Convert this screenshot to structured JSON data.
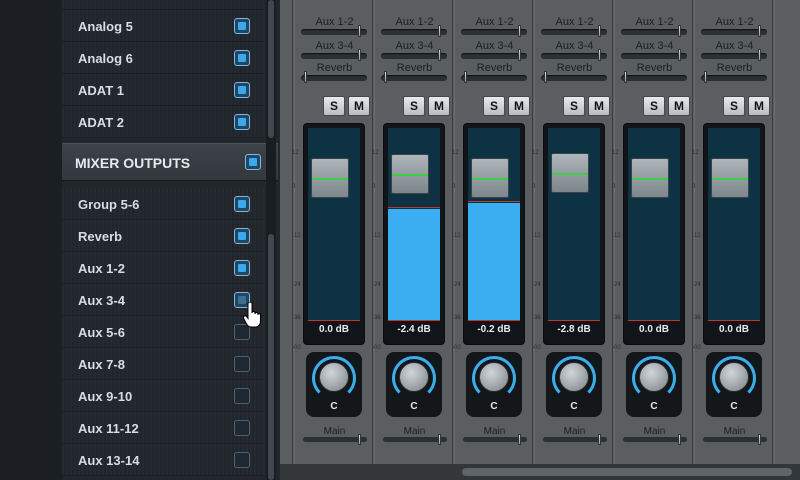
{
  "sidebar": {
    "inputs": [
      {
        "label": "Analog 5",
        "checked": true
      },
      {
        "label": "Analog 6",
        "checked": true
      },
      {
        "label": "ADAT 1",
        "checked": true
      },
      {
        "label": "ADAT 2",
        "checked": true
      }
    ],
    "mixer_outputs_header": "MIXER OUTPUTS",
    "outputs": [
      {
        "label": "Group 5-6",
        "checked": true
      },
      {
        "label": "Reverb",
        "checked": true
      },
      {
        "label": "Aux 1-2",
        "checked": true
      },
      {
        "label": "Aux 3-4",
        "checked": false,
        "hover": true
      },
      {
        "label": "Aux 5-6",
        "checked": false
      },
      {
        "label": "Aux 7-8",
        "checked": false
      },
      {
        "label": "Aux 9-10",
        "checked": false
      },
      {
        "label": "Aux 11-12",
        "checked": false
      },
      {
        "label": "Aux 13-14",
        "checked": false
      }
    ]
  },
  "mixer": {
    "solo_label": "S",
    "mute_label": "M",
    "main_label": "Main",
    "scale_labels": [
      "12",
      "0",
      "-12",
      "-24",
      "-36",
      "-00"
    ],
    "channels": [
      {
        "sends": [
          {
            "name": "Aux 1-2",
            "level": 0.92
          },
          {
            "name": "Aux 3-4",
            "level": 0.92
          },
          {
            "name": "Reverb",
            "level": 0.05
          }
        ],
        "db": "0.0 dB",
        "meter": 0.0,
        "fader": 0.0,
        "pan": "C",
        "main": 0.88
      },
      {
        "sends": [
          {
            "name": "Aux 1-2",
            "level": 0.92
          },
          {
            "name": "Aux 3-4",
            "level": 0.92
          },
          {
            "name": "Reverb",
            "level": 0.05
          }
        ],
        "db": "-2.4 dB",
        "meter": 0.58,
        "fader": -2.4,
        "pan": "C",
        "main": 0.88
      },
      {
        "sends": [
          {
            "name": "Aux 1-2",
            "level": 0.92
          },
          {
            "name": "Aux 3-4",
            "level": 0.92
          },
          {
            "name": "Reverb",
            "level": 0.05
          }
        ],
        "db": "-0.2 dB",
        "meter": 0.61,
        "fader": -0.2,
        "pan": "C",
        "main": 0.88
      },
      {
        "sends": [
          {
            "name": "Aux 1-2",
            "level": 0.92
          },
          {
            "name": "Aux 3-4",
            "level": 0.92
          },
          {
            "name": "Reverb",
            "level": 0.05
          }
        ],
        "db": "-2.8 dB",
        "meter": 0.0,
        "fader": -2.8,
        "pan": "C",
        "main": 0.88
      },
      {
        "sends": [
          {
            "name": "Aux 1-2",
            "level": 0.92
          },
          {
            "name": "Aux 3-4",
            "level": 0.92
          },
          {
            "name": "Reverb",
            "level": 0.05
          }
        ],
        "db": "0.0 dB",
        "meter": 0.0,
        "fader": 0.0,
        "pan": "C",
        "main": 0.88
      },
      {
        "sends": [
          {
            "name": "Aux 1-2",
            "level": 0.92
          },
          {
            "name": "Aux 3-4",
            "level": 0.92
          },
          {
            "name": "Reverb",
            "level": 0.05
          }
        ],
        "db": "0.0 dB",
        "meter": 0.0,
        "fader": 0.0,
        "pan": "C",
        "main": 0.88
      }
    ]
  },
  "colors": {
    "accent": "#3aaef0",
    "fader_line": "#3ecf4a",
    "clip": "#c0392b"
  }
}
